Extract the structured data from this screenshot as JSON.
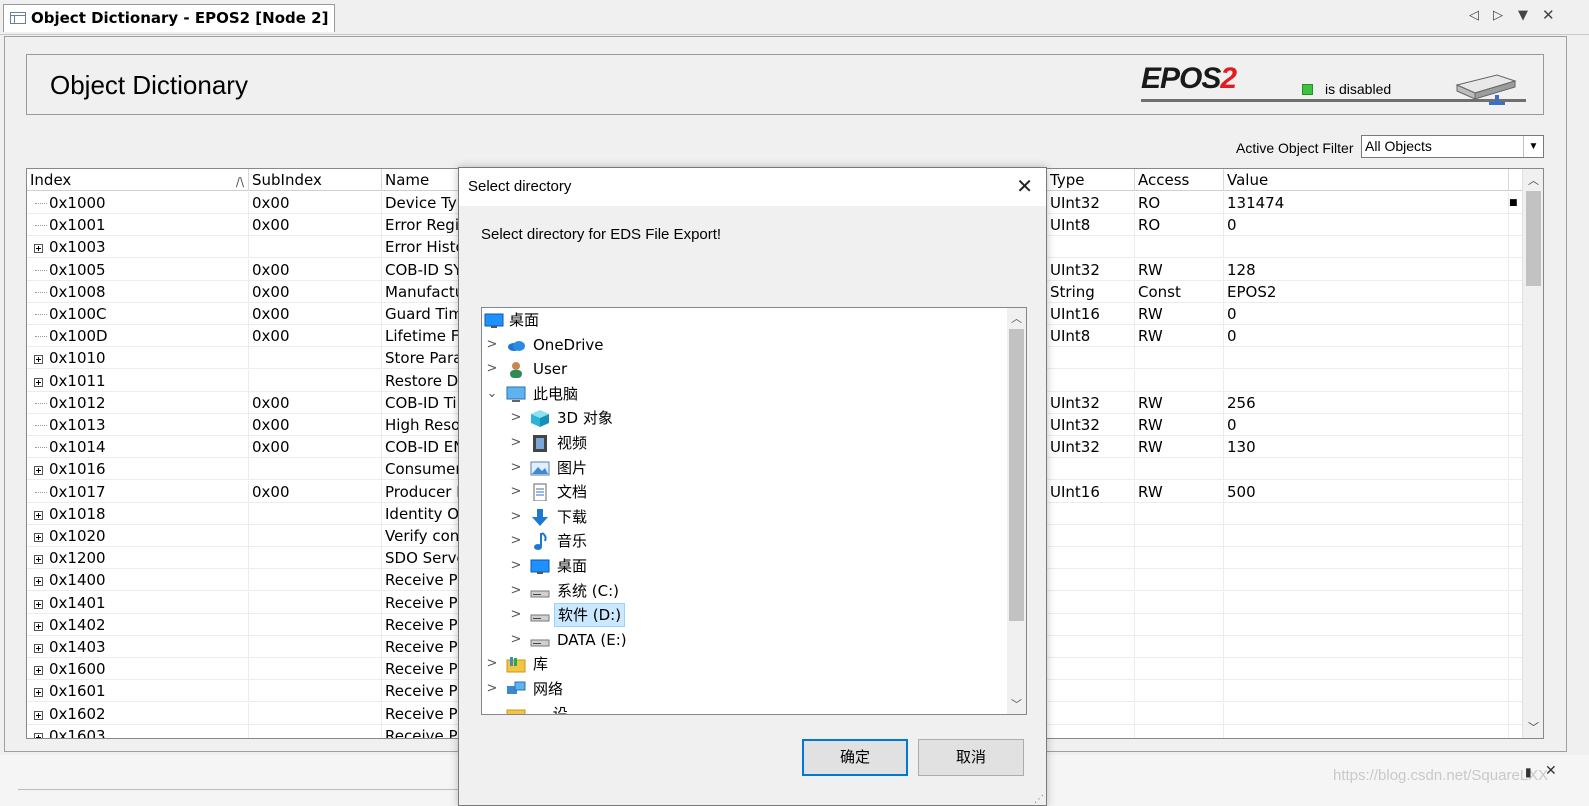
{
  "window": {
    "tab_title": "Object Dictionary - EPOS2 [Node 2]"
  },
  "header": {
    "title": "Object Dictionary",
    "brand": "EPOS",
    "brand_suffix": "2",
    "status": "is disabled",
    "status_color": "#3cc43c"
  },
  "filter": {
    "label": "Active Object Filter",
    "value": "All Objects"
  },
  "grid": {
    "columns": {
      "index": "Index",
      "subindex": "SubIndex",
      "name": "Name",
      "type": "Type",
      "access": "Access",
      "value": "Value"
    },
    "rows": [
      {
        "index": "0x1000",
        "sub": "0x00",
        "name": "Device Typ",
        "type": "UInt32",
        "access": "RO",
        "value": "131474",
        "exp": false
      },
      {
        "index": "0x1001",
        "sub": "0x00",
        "name": "Error Regi",
        "type": "UInt8",
        "access": "RO",
        "value": "0",
        "exp": false
      },
      {
        "index": "0x1003",
        "sub": "",
        "name": "Error Histo",
        "type": "",
        "access": "",
        "value": "",
        "exp": true
      },
      {
        "index": "0x1005",
        "sub": "0x00",
        "name": "COB-ID SY",
        "type": "UInt32",
        "access": "RW",
        "value": "128",
        "exp": false
      },
      {
        "index": "0x1008",
        "sub": "0x00",
        "name": "Manufactu",
        "type": "String",
        "access": "Const",
        "value": "EPOS2",
        "exp": false
      },
      {
        "index": "0x100C",
        "sub": "0x00",
        "name": "Guard Tim",
        "type": "UInt16",
        "access": "RW",
        "value": "0",
        "exp": false
      },
      {
        "index": "0x100D",
        "sub": "0x00",
        "name": "Lifetime Fa",
        "type": "UInt8",
        "access": "RW",
        "value": "0",
        "exp": false
      },
      {
        "index": "0x1010",
        "sub": "",
        "name": "Store Para",
        "type": "",
        "access": "",
        "value": "",
        "exp": true
      },
      {
        "index": "0x1011",
        "sub": "",
        "name": "Restore D",
        "type": "",
        "access": "",
        "value": "",
        "exp": true
      },
      {
        "index": "0x1012",
        "sub": "0x00",
        "name": "COB-ID Ti",
        "type": "UInt32",
        "access": "RW",
        "value": "256",
        "exp": false
      },
      {
        "index": "0x1013",
        "sub": "0x00",
        "name": "High Reso",
        "type": "UInt32",
        "access": "RW",
        "value": "0",
        "exp": false
      },
      {
        "index": "0x1014",
        "sub": "0x00",
        "name": "COB-ID EN",
        "type": "UInt32",
        "access": "RW",
        "value": "130",
        "exp": false
      },
      {
        "index": "0x1016",
        "sub": "",
        "name": "Consumer",
        "type": "",
        "access": "",
        "value": "",
        "exp": true
      },
      {
        "index": "0x1017",
        "sub": "0x00",
        "name": "Producer I",
        "type": "UInt16",
        "access": "RW",
        "value": "500",
        "exp": false
      },
      {
        "index": "0x1018",
        "sub": "",
        "name": "Identity Ol",
        "type": "",
        "access": "",
        "value": "",
        "exp": true
      },
      {
        "index": "0x1020",
        "sub": "",
        "name": "Verify con",
        "type": "",
        "access": "",
        "value": "",
        "exp": true
      },
      {
        "index": "0x1200",
        "sub": "",
        "name": "SDO Serve",
        "type": "",
        "access": "",
        "value": "",
        "exp": true
      },
      {
        "index": "0x1400",
        "sub": "",
        "name": "Receive PD",
        "type": "",
        "access": "",
        "value": "",
        "exp": true
      },
      {
        "index": "0x1401",
        "sub": "",
        "name": "Receive PD",
        "type": "",
        "access": "",
        "value": "",
        "exp": true
      },
      {
        "index": "0x1402",
        "sub": "",
        "name": "Receive PD",
        "type": "",
        "access": "",
        "value": "",
        "exp": true
      },
      {
        "index": "0x1403",
        "sub": "",
        "name": "Receive PD",
        "type": "",
        "access": "",
        "value": "",
        "exp": true
      },
      {
        "index": "0x1600",
        "sub": "",
        "name": "Receive PD",
        "type": "",
        "access": "",
        "value": "",
        "exp": true
      },
      {
        "index": "0x1601",
        "sub": "",
        "name": "Receive PD",
        "type": "",
        "access": "",
        "value": "",
        "exp": true
      },
      {
        "index": "0x1602",
        "sub": "",
        "name": "Receive PD",
        "type": "",
        "access": "",
        "value": "",
        "exp": true
      },
      {
        "index": "0x1603",
        "sub": "",
        "name": "Receive PD",
        "type": "",
        "access": "",
        "value": "",
        "exp": true
      }
    ]
  },
  "dialog": {
    "title": "Select directory",
    "message": "Select directory for EDS File Export!",
    "tree": [
      {
        "label": "桌面",
        "level": 0,
        "chev": "",
        "icon": "desktop-icon"
      },
      {
        "label": "OneDrive",
        "level": 1,
        "chev": "›",
        "icon": "cloud-icon"
      },
      {
        "label": "User",
        "level": 1,
        "chev": "›",
        "icon": "user-icon"
      },
      {
        "label": "此电脑",
        "level": 1,
        "chev": "⌄",
        "icon": "computer-icon"
      },
      {
        "label": "3D 对象",
        "level": 2,
        "chev": "›",
        "icon": "cube-icon"
      },
      {
        "label": "视频",
        "level": 2,
        "chev": "›",
        "icon": "video-icon"
      },
      {
        "label": "图片",
        "level": 2,
        "chev": "›",
        "icon": "picture-icon"
      },
      {
        "label": "文档",
        "level": 2,
        "chev": "›",
        "icon": "document-icon"
      },
      {
        "label": "下载",
        "level": 2,
        "chev": "›",
        "icon": "download-icon"
      },
      {
        "label": "音乐",
        "level": 2,
        "chev": "›",
        "icon": "music-icon"
      },
      {
        "label": "桌面",
        "level": 2,
        "chev": "›",
        "icon": "desktop-icon"
      },
      {
        "label": "系统 (C:)",
        "level": 2,
        "chev": "›",
        "icon": "drive-icon"
      },
      {
        "label": "软件 (D:)",
        "level": 2,
        "chev": "›",
        "icon": "drive-icon",
        "selected": true
      },
      {
        "label": "DATA (E:)",
        "level": 2,
        "chev": "›",
        "icon": "drive-icon"
      },
      {
        "label": "库",
        "level": 1,
        "chev": "›",
        "icon": "library-icon"
      },
      {
        "label": "网络",
        "level": 1,
        "chev": "›",
        "icon": "network-icon"
      },
      {
        "label": "… 设",
        "level": 1,
        "chev": "",
        "icon": "folder-icon"
      }
    ],
    "ok_label": "确定",
    "cancel_label": "取消"
  },
  "footer": {
    "watermark": "https://blog.csdn.net/SquareLXX"
  }
}
